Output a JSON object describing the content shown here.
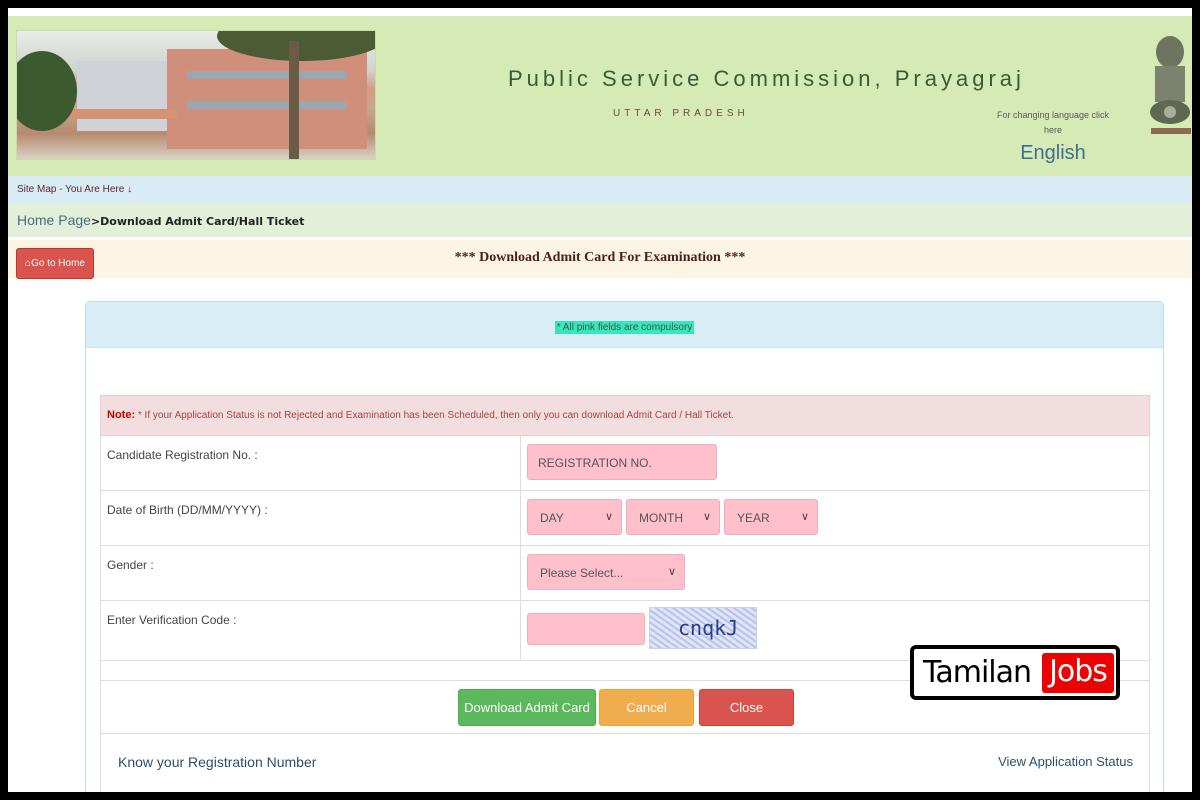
{
  "header": {
    "title": "Public Service Commission, Prayagraj",
    "subtitle": "UTTAR PRADESH",
    "language_prompt": "For changing language click here",
    "language_link": "English",
    "emblem_icon": "state-emblem-icon",
    "photo": "building-photo"
  },
  "sitemap": {
    "label": "Site Map - You Are Here ↓"
  },
  "breadcrumb": {
    "home": "Home Page",
    "separator": ">",
    "current": "Download Admit Card/Hall Ticket"
  },
  "toolbar": {
    "go_home_icon": "home-icon",
    "go_home_label": "Go to Home"
  },
  "page": {
    "heading": "*** Download Admit Card For Examination ***"
  },
  "form": {
    "hint": "* All pink fields are compulsory",
    "note_label": "Note:",
    "note_text": " * If your Application Status is not Rejected and Examination has been Scheduled, then only you can download Admit Card / Hall Ticket.",
    "fields": {
      "registration": {
        "label": "Candidate Registration No. :",
        "placeholder": "REGISTRATION NO.",
        "value": ""
      },
      "dob": {
        "label": "Date of Birth (DD/MM/YYYY) :",
        "day": "DAY",
        "month": "MONTH",
        "year": "YEAR"
      },
      "gender": {
        "label": "Gender :",
        "selected": "Please Select..."
      },
      "captcha": {
        "label": "Enter Verification Code :",
        "value": "",
        "code": "cnqkJ"
      }
    },
    "buttons": {
      "download": "Download Admit Card",
      "cancel": "Cancel",
      "close": "Close"
    },
    "links": {
      "know_registration": "Know your Registration Number",
      "view_status": "View Application Status"
    }
  },
  "watermark": {
    "text": "Tamilan",
    "highlight": "Jobs",
    "accent": "#ee0000"
  },
  "colors": {
    "header_bg": "#d5eab5",
    "pink_field": "#ffc0cb",
    "success": "#5cb85c",
    "warning": "#f0ad4e",
    "danger": "#d9534f"
  }
}
